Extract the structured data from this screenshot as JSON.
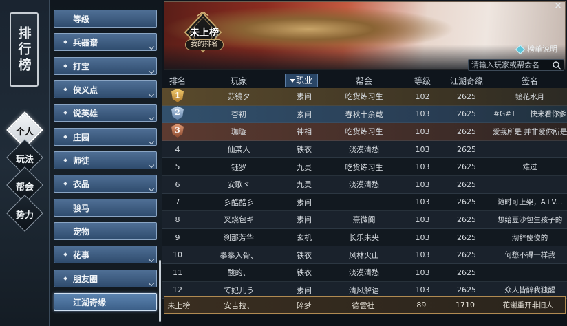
{
  "sidebar": {
    "title": "排行榜",
    "tabs": [
      {
        "label": "个人",
        "active": true
      },
      {
        "label": "玩法",
        "active": false
      },
      {
        "label": "帮会",
        "active": false
      },
      {
        "label": "势力",
        "active": false
      }
    ]
  },
  "categories": [
    {
      "label": "等级",
      "expandable": false
    },
    {
      "label": "兵器谱",
      "expandable": true
    },
    {
      "label": "打宝",
      "expandable": true
    },
    {
      "label": "侠义点",
      "expandable": true
    },
    {
      "label": "说英雄",
      "expandable": true
    },
    {
      "label": "庄园",
      "expandable": true
    },
    {
      "label": "师徒",
      "expandable": true
    },
    {
      "label": "衣品",
      "expandable": true
    },
    {
      "label": "骏马",
      "expandable": false
    },
    {
      "label": "宠物",
      "expandable": false
    },
    {
      "label": "花事",
      "expandable": true
    },
    {
      "label": "朋友圈",
      "expandable": true
    },
    {
      "label": "江湖奇缘",
      "expandable": false,
      "selected": true
    }
  ],
  "banner": {
    "rank_status": "未上榜",
    "my_rank_button": "我的排名",
    "rules_button": "榜单说明"
  },
  "search": {
    "placeholder": "请输入玩家或帮会名"
  },
  "table": {
    "headers": {
      "rank": "排名",
      "player": "玩家",
      "class": "职业",
      "guild": "帮会",
      "level": "等级",
      "jianghu": "江湖奇缘",
      "signature": "签名"
    },
    "sorted_column": "class",
    "rows": [
      {
        "rank": "1",
        "player": "苏镜夕",
        "class": "素问",
        "guild": "吃货练习生",
        "level": "102",
        "jianghu": "2625",
        "signature": "镜花水月"
      },
      {
        "rank": "2",
        "player": "杏初",
        "class": "素问",
        "guild": "春秋十余载",
        "level": "103",
        "jianghu": "2625",
        "signature": "#G#T　　快来看你爹"
      },
      {
        "rank": "3",
        "player": "珈璇",
        "class": "神相",
        "guild": "吃货练习生",
        "level": "103",
        "jianghu": "2625",
        "signature": "爱我所是 并非爱你所是"
      },
      {
        "rank": "4",
        "player": "仙某人",
        "class": "铁衣",
        "guild": "淡漠清愁",
        "level": "103",
        "jianghu": "2625",
        "signature": ""
      },
      {
        "rank": "5",
        "player": "钰罗",
        "class": "九灵",
        "guild": "吃货练习生",
        "level": "103",
        "jianghu": "2625",
        "signature": "难过"
      },
      {
        "rank": "6",
        "player": "安歌ヾ",
        "class": "九灵",
        "guild": "淡漠清愁",
        "level": "103",
        "jianghu": "2625",
        "signature": ""
      },
      {
        "rank": "7",
        "player": "彡酷酷彡",
        "class": "素问",
        "guild": "",
        "level": "103",
        "jianghu": "2625",
        "signature": "随时可上架，A+V..."
      },
      {
        "rank": "8",
        "player": "叉烧包ギ",
        "class": "素问",
        "guild": "熹微阁",
        "level": "103",
        "jianghu": "2625",
        "signature": "想给豆沙包生孩子的"
      },
      {
        "rank": "9",
        "player": "刹那芳华",
        "class": "玄机",
        "guild": "长乐未央",
        "level": "103",
        "jianghu": "2625",
        "signature": "沏辞傻傻的"
      },
      {
        "rank": "10",
        "player": "拳拳入骨、",
        "class": "铁衣",
        "guild": "风林火山",
        "level": "103",
        "jianghu": "2625",
        "signature": "何愁不得一样我"
      },
      {
        "rank": "11",
        "player": "酸的、",
        "class": "铁衣",
        "guild": "淡漠清愁",
        "level": "103",
        "jianghu": "2625",
        "signature": ""
      },
      {
        "rank": "12",
        "player": "て妃儿う",
        "class": "素问",
        "guild": "清风解语",
        "level": "103",
        "jianghu": "2625",
        "signature": "众人皆醉我独醒"
      }
    ],
    "my_row": {
      "rank": "未上榜",
      "player": "安吉拉、",
      "class": "碎梦",
      "guild": "德雲社",
      "level": "89",
      "jianghu": "1710",
      "signature": "花谢重开非旧人"
    }
  },
  "colors": {
    "category_button": "#3f5f84",
    "gold_medal": "#d2a24a",
    "silver_medal": "#7c9cc0",
    "bronze_medal": "#b86a48",
    "my_row_border": "#b08a52"
  }
}
